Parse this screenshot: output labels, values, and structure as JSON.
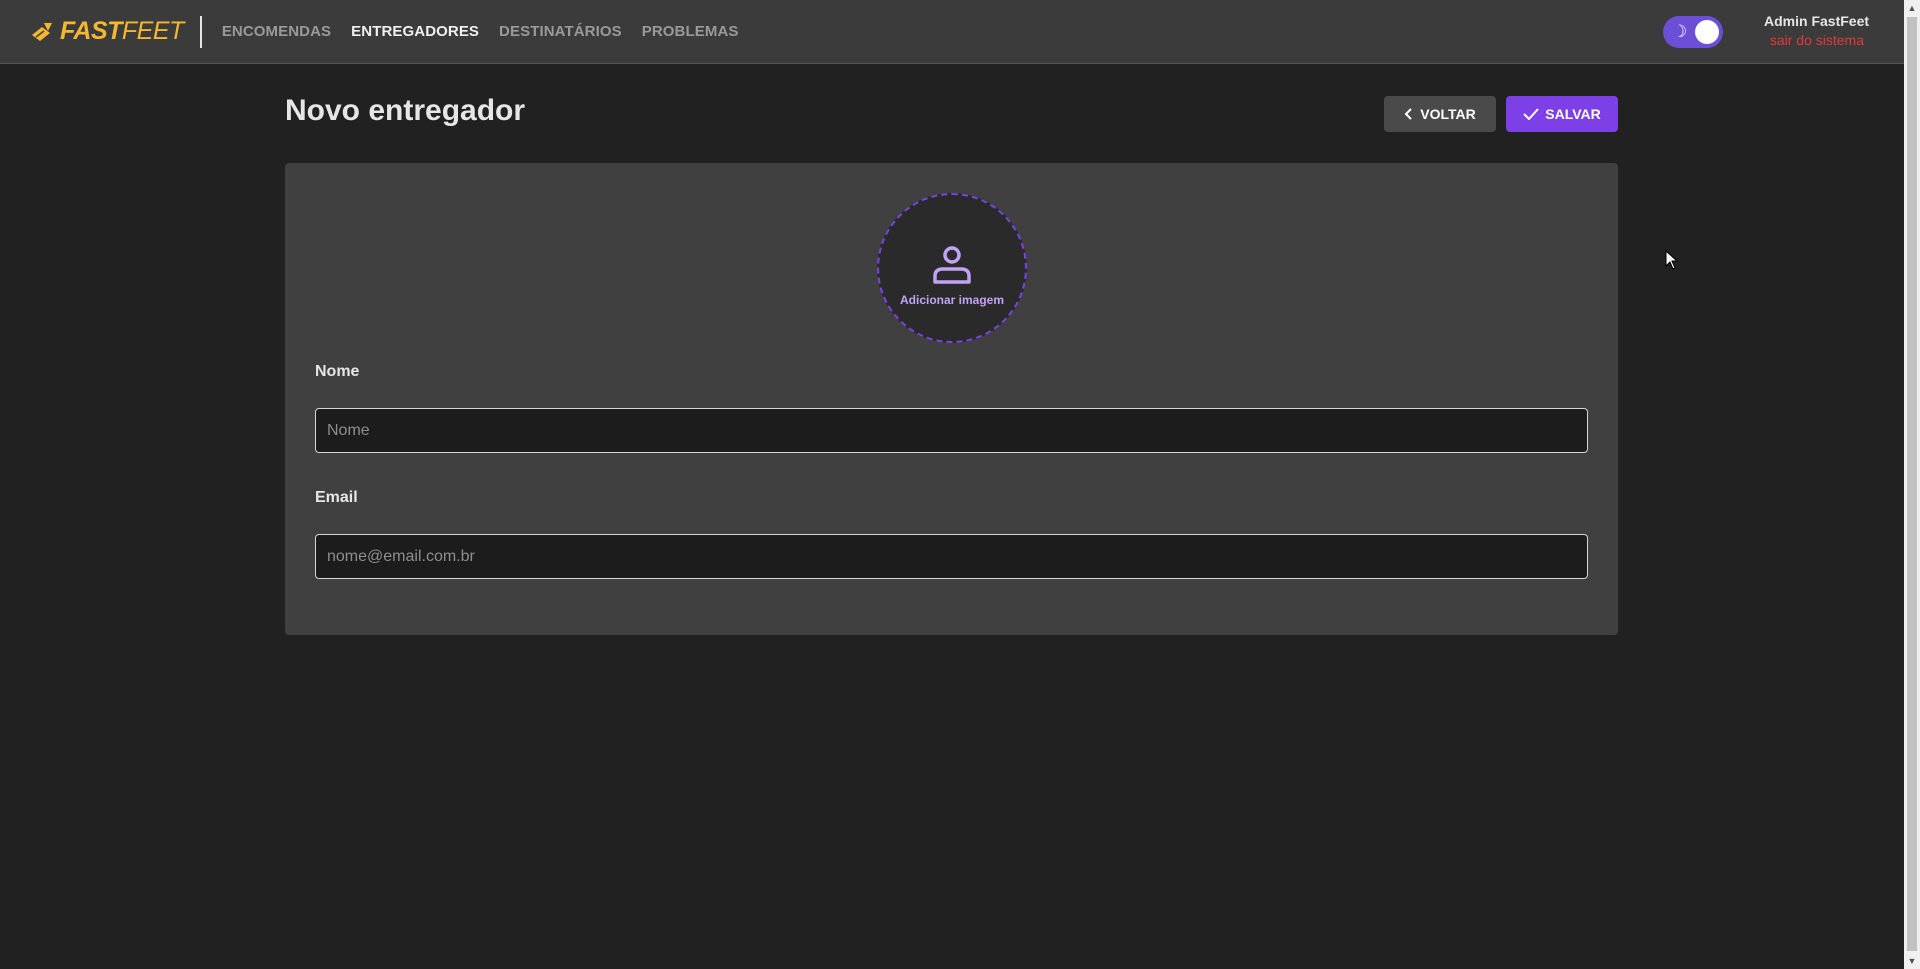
{
  "app": {
    "logo_bold": "FAST",
    "logo_light": "FEET"
  },
  "nav": {
    "items": [
      {
        "label": "ENCOMENDAS",
        "active": false
      },
      {
        "label": "ENTREGADORES",
        "active": true
      },
      {
        "label": "DESTINATÁRIOS",
        "active": false
      },
      {
        "label": "PROBLEMAS",
        "active": false
      }
    ]
  },
  "user": {
    "name": "Admin FastFeet",
    "logout_label": "sair do sistema"
  },
  "theme_toggle": {
    "icon": "moon-icon",
    "state": "dark"
  },
  "main": {
    "title": "Novo entregador",
    "back_label": "VOLTAR",
    "save_label": "SALVAR",
    "avatar_label": "Adicionar imagem",
    "fields": {
      "name": {
        "label": "Nome",
        "placeholder": "Nome",
        "value": ""
      },
      "email": {
        "label": "Email",
        "placeholder": "nome@email.com.br",
        "value": ""
      }
    }
  },
  "colors": {
    "brand": "#f5b730",
    "accent": "#7d40e7",
    "toggle": "#6c4fd6",
    "danger": "#de3b3b",
    "header_bg": "#3b3b3b",
    "page_bg": "#212121",
    "card_bg": "#404040"
  }
}
